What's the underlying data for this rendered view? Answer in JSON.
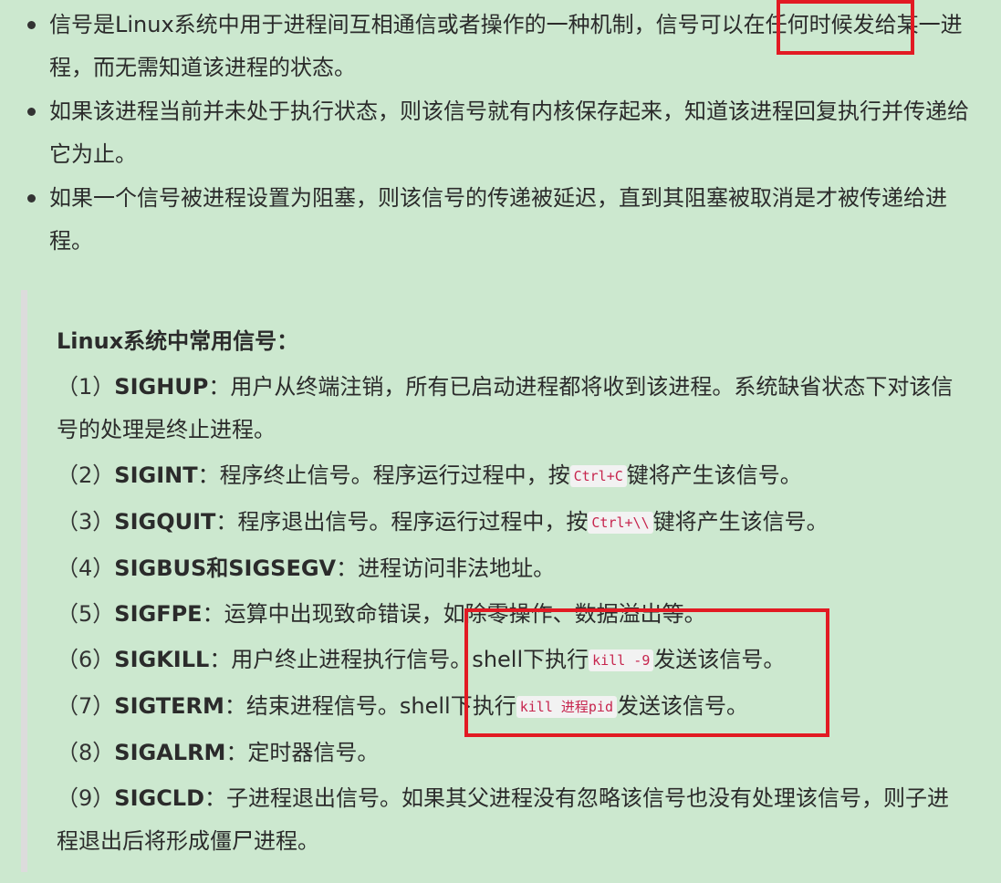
{
  "bullets": [
    {
      "text": "信号是Linux系统中用于进程间互相通信或者操作的一种机制，信号可以在任何时候发给某一进程，而无需知道该进程的状态。"
    },
    {
      "text": "如果该进程当前并未处于执行状态，则该信号就有内核保存起来，知道该进程回复执行并传递给它为止。"
    },
    {
      "text": "如果一个信号被进程设置为阻塞，则该信号的传递被延迟，直到其阻塞被取消是才被传递给进程。"
    }
  ],
  "quote": {
    "title": "Linux系统中常用信号：",
    "items": [
      {
        "num": "（1）",
        "sig": "SIGHUP",
        "text": "：用户从终端注销，所有已启动进程都将收到该进程。系统缺省状态下对该信号的处理是终止进程。"
      },
      {
        "num": "（2）",
        "sig": "SIGINT",
        "pre": "：程序终止信号。程序运行过程中，按",
        "code": "Ctrl+C",
        "post": "键将产生该信号。"
      },
      {
        "num": "（3）",
        "sig": "SIGQUIT",
        "pre": "：程序退出信号。程序运行过程中，按",
        "code": "Ctrl+\\\\",
        "post": "键将产生该信号。"
      },
      {
        "num": "（4）",
        "sig": "SIGBUS和SIGSEGV",
        "text": "：进程访问非法地址。"
      },
      {
        "num": "（5）",
        "sig": "SIGFPE",
        "text": "：运算中出现致命错误，如除零操作、数据溢出等。"
      },
      {
        "num": "（6）",
        "sig": "SIGKILL",
        "pre": "：用户终止进程执行信号。shell下执行",
        "code": "kill -9",
        "post": "发送该信号。"
      },
      {
        "num": "（7）",
        "sig": "SIGTERM",
        "pre": "：结束进程信号。shell下执行",
        "code": "kill 进程pid",
        "post": "发送该信号。"
      },
      {
        "num": "（8）",
        "sig": "SIGALRM",
        "text": "：定时器信号。"
      },
      {
        "num": "（9）",
        "sig": "SIGCLD",
        "text": "：子进程退出信号。如果其父进程没有忽略该信号也没有处理该信号，则子进程退出后将形成僵尸进程。"
      }
    ]
  },
  "colors": {
    "background": "#cce8cf",
    "highlight_box": "#e21a23",
    "code_text": "#c7254e"
  }
}
